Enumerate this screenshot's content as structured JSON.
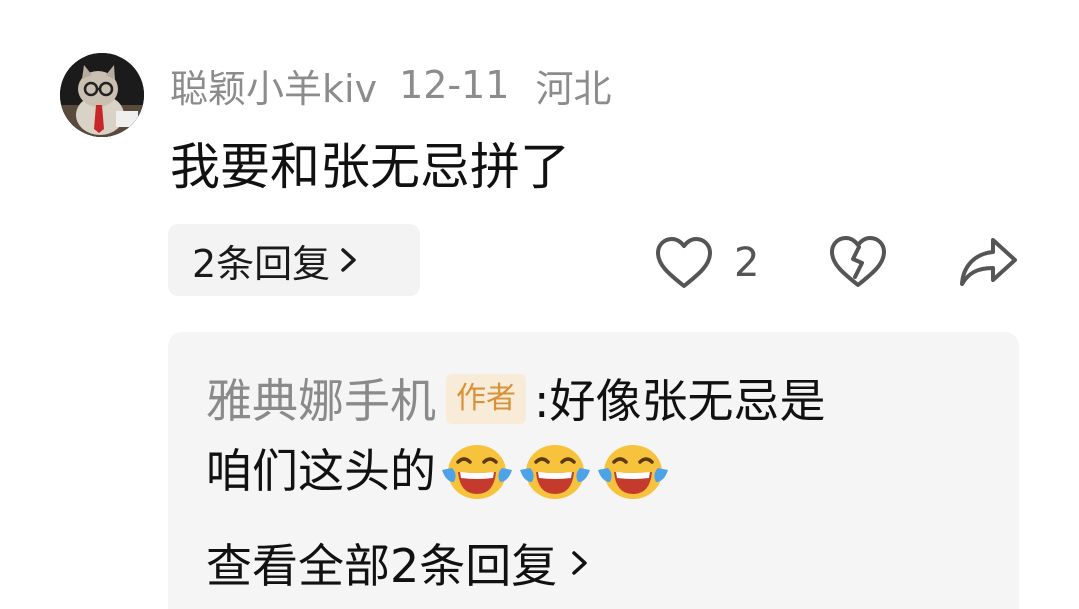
{
  "comment": {
    "username": "聪颖小羊kiv",
    "date": "12-11",
    "location": "河北",
    "text": "我要和张无忌拼了",
    "replies_button_label": "2条回复",
    "like_count": "2",
    "avatar_icon": "cat-with-glasses-avatar"
  },
  "reply_preview": {
    "username": "雅典娜手机",
    "author_tag": "作者",
    "separator": ":",
    "text_line1": "好像张无忌是",
    "text_line2": "咱们这头的",
    "emoji_icon": "laughing-crying-emoji",
    "emoji_count": 3,
    "view_all_label": "查看全部2条回复"
  },
  "colors": {
    "meta_gray": "#8c8c8c",
    "author_tag_text": "#d89238",
    "author_tag_bg": "#f8ecd9",
    "reply_box_bg": "#f5f5f5"
  }
}
